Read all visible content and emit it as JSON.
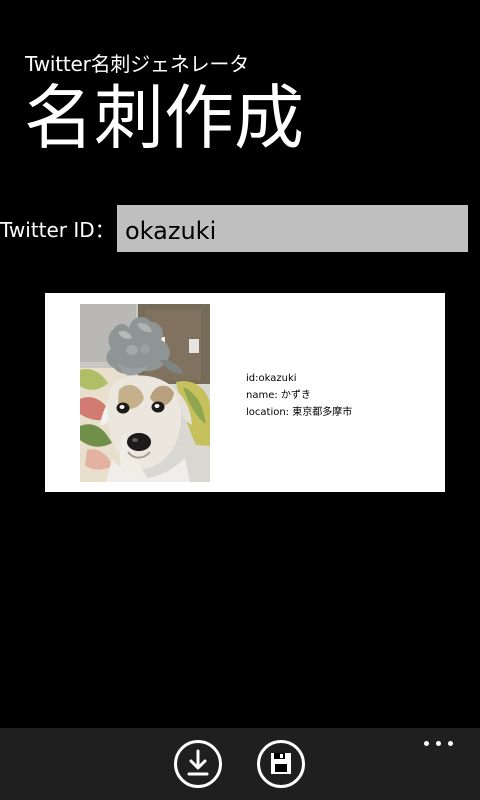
{
  "app": {
    "name": "Twitter名刺ジェネレータ",
    "page_title": "名刺作成"
  },
  "form": {
    "twitter_label": "Twitter ID：",
    "twitter_value": "okazuki"
  },
  "business_card": {
    "id_line": "id:okazuki",
    "name_line": "name: かずき",
    "location_line": "location: 東京都多摩市"
  },
  "app_bar": {
    "download_button": {
      "icon": "download-icon"
    },
    "save_button": {
      "icon": "floppy-disk-icon"
    },
    "more_button": {
      "icon": "ellipsis-icon"
    }
  },
  "colors": {
    "background": "#000000",
    "input_background": "#bfbfbf",
    "card_background": "#ffffff",
    "app_bar_background": "#1f1f1f",
    "text_primary": "#ffffff",
    "card_text": "#000000"
  }
}
